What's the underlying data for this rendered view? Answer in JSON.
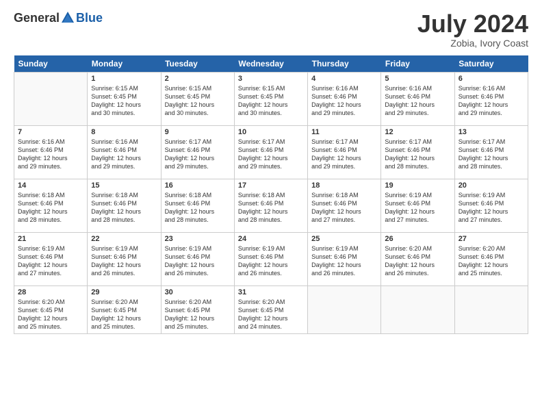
{
  "header": {
    "logo_general": "General",
    "logo_blue": "Blue",
    "title": "July 2024",
    "subtitle": "Zobia, Ivory Coast"
  },
  "days_of_week": [
    "Sunday",
    "Monday",
    "Tuesday",
    "Wednesday",
    "Thursday",
    "Friday",
    "Saturday"
  ],
  "weeks": [
    [
      {
        "day": "",
        "info": ""
      },
      {
        "day": "1",
        "info": "Sunrise: 6:15 AM\nSunset: 6:45 PM\nDaylight: 12 hours\nand 30 minutes."
      },
      {
        "day": "2",
        "info": "Sunrise: 6:15 AM\nSunset: 6:45 PM\nDaylight: 12 hours\nand 30 minutes."
      },
      {
        "day": "3",
        "info": "Sunrise: 6:15 AM\nSunset: 6:45 PM\nDaylight: 12 hours\nand 30 minutes."
      },
      {
        "day": "4",
        "info": "Sunrise: 6:16 AM\nSunset: 6:46 PM\nDaylight: 12 hours\nand 29 minutes."
      },
      {
        "day": "5",
        "info": "Sunrise: 6:16 AM\nSunset: 6:46 PM\nDaylight: 12 hours\nand 29 minutes."
      },
      {
        "day": "6",
        "info": "Sunrise: 6:16 AM\nSunset: 6:46 PM\nDaylight: 12 hours\nand 29 minutes."
      }
    ],
    [
      {
        "day": "7",
        "info": "Sunrise: 6:16 AM\nSunset: 6:46 PM\nDaylight: 12 hours\nand 29 minutes."
      },
      {
        "day": "8",
        "info": "Sunrise: 6:16 AM\nSunset: 6:46 PM\nDaylight: 12 hours\nand 29 minutes."
      },
      {
        "day": "9",
        "info": "Sunrise: 6:17 AM\nSunset: 6:46 PM\nDaylight: 12 hours\nand 29 minutes."
      },
      {
        "day": "10",
        "info": "Sunrise: 6:17 AM\nSunset: 6:46 PM\nDaylight: 12 hours\nand 29 minutes."
      },
      {
        "day": "11",
        "info": "Sunrise: 6:17 AM\nSunset: 6:46 PM\nDaylight: 12 hours\nand 29 minutes."
      },
      {
        "day": "12",
        "info": "Sunrise: 6:17 AM\nSunset: 6:46 PM\nDaylight: 12 hours\nand 28 minutes."
      },
      {
        "day": "13",
        "info": "Sunrise: 6:17 AM\nSunset: 6:46 PM\nDaylight: 12 hours\nand 28 minutes."
      }
    ],
    [
      {
        "day": "14",
        "info": "Sunrise: 6:18 AM\nSunset: 6:46 PM\nDaylight: 12 hours\nand 28 minutes."
      },
      {
        "day": "15",
        "info": "Sunrise: 6:18 AM\nSunset: 6:46 PM\nDaylight: 12 hours\nand 28 minutes."
      },
      {
        "day": "16",
        "info": "Sunrise: 6:18 AM\nSunset: 6:46 PM\nDaylight: 12 hours\nand 28 minutes."
      },
      {
        "day": "17",
        "info": "Sunrise: 6:18 AM\nSunset: 6:46 PM\nDaylight: 12 hours\nand 28 minutes."
      },
      {
        "day": "18",
        "info": "Sunrise: 6:18 AM\nSunset: 6:46 PM\nDaylight: 12 hours\nand 27 minutes."
      },
      {
        "day": "19",
        "info": "Sunrise: 6:19 AM\nSunset: 6:46 PM\nDaylight: 12 hours\nand 27 minutes."
      },
      {
        "day": "20",
        "info": "Sunrise: 6:19 AM\nSunset: 6:46 PM\nDaylight: 12 hours\nand 27 minutes."
      }
    ],
    [
      {
        "day": "21",
        "info": "Sunrise: 6:19 AM\nSunset: 6:46 PM\nDaylight: 12 hours\nand 27 minutes."
      },
      {
        "day": "22",
        "info": "Sunrise: 6:19 AM\nSunset: 6:46 PM\nDaylight: 12 hours\nand 26 minutes."
      },
      {
        "day": "23",
        "info": "Sunrise: 6:19 AM\nSunset: 6:46 PM\nDaylight: 12 hours\nand 26 minutes."
      },
      {
        "day": "24",
        "info": "Sunrise: 6:19 AM\nSunset: 6:46 PM\nDaylight: 12 hours\nand 26 minutes."
      },
      {
        "day": "25",
        "info": "Sunrise: 6:19 AM\nSunset: 6:46 PM\nDaylight: 12 hours\nand 26 minutes."
      },
      {
        "day": "26",
        "info": "Sunrise: 6:20 AM\nSunset: 6:46 PM\nDaylight: 12 hours\nand 26 minutes."
      },
      {
        "day": "27",
        "info": "Sunrise: 6:20 AM\nSunset: 6:46 PM\nDaylight: 12 hours\nand 25 minutes."
      }
    ],
    [
      {
        "day": "28",
        "info": "Sunrise: 6:20 AM\nSunset: 6:45 PM\nDaylight: 12 hours\nand 25 minutes."
      },
      {
        "day": "29",
        "info": "Sunrise: 6:20 AM\nSunset: 6:45 PM\nDaylight: 12 hours\nand 25 minutes."
      },
      {
        "day": "30",
        "info": "Sunrise: 6:20 AM\nSunset: 6:45 PM\nDaylight: 12 hours\nand 25 minutes."
      },
      {
        "day": "31",
        "info": "Sunrise: 6:20 AM\nSunset: 6:45 PM\nDaylight: 12 hours\nand 24 minutes."
      },
      {
        "day": "",
        "info": ""
      },
      {
        "day": "",
        "info": ""
      },
      {
        "day": "",
        "info": ""
      }
    ]
  ]
}
